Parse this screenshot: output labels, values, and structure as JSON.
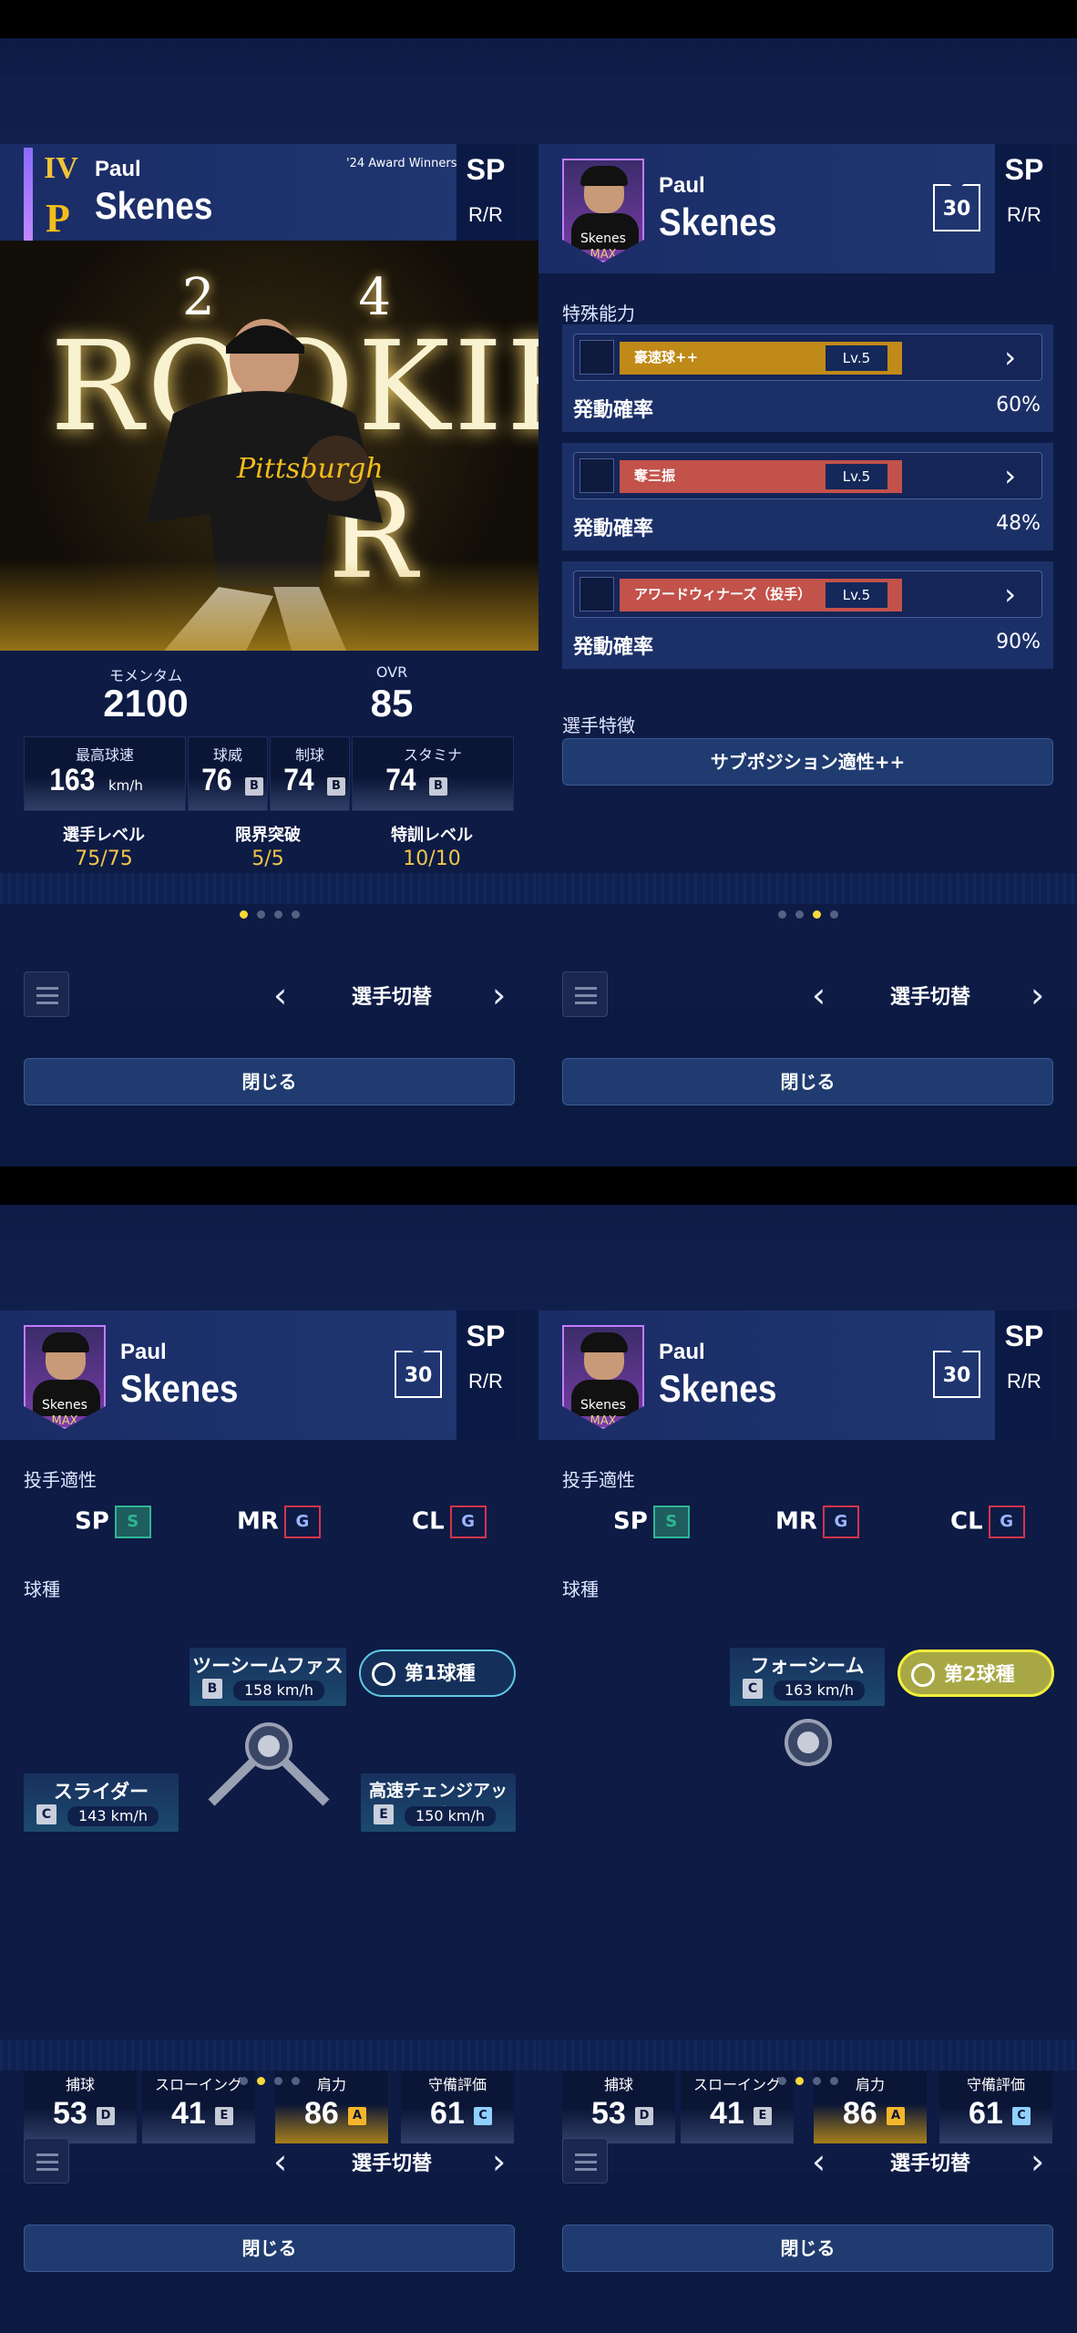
{
  "player": {
    "first": "Paul",
    "last": "Skenes",
    "position": "SP",
    "throws": "R/R",
    "number": "30",
    "rank": "IV",
    "max": "MAX",
    "avatar_name": "Skenes",
    "award": "'24 Award Winners"
  },
  "card": {
    "year": "2 4",
    "word1": "ROOKIE",
    "word2": "R"
  },
  "stats": {
    "momentum_label": "モメンタム",
    "momentum": "2100",
    "ovr_label": "OVR",
    "ovr": "85"
  },
  "attrs": [
    {
      "label": "最高球速",
      "value": "163",
      "unit": "km/h",
      "grade": ""
    },
    {
      "label": "球威",
      "value": "76",
      "grade": "B"
    },
    {
      "label": "制球",
      "value": "74",
      "grade": "B"
    },
    {
      "label": "スタミナ",
      "value": "74",
      "grade": "B"
    }
  ],
  "levels": [
    {
      "label": "選手レベル",
      "value": "75/75"
    },
    {
      "label": "限界突破",
      "value": "5/5"
    },
    {
      "label": "特訓レベル",
      "value": "10/10"
    }
  ],
  "abilities_title": "特殊能力",
  "abilities": [
    {
      "name": "豪速球++",
      "lv": "Lv.5",
      "rate_label": "発動確率",
      "rate": "60%",
      "color": "#c08a18"
    },
    {
      "name": "奪三振",
      "lv": "Lv.5",
      "rate_label": "発動確率",
      "rate": "48%",
      "color": "#c2524a"
    },
    {
      "name": "アワードウィナーズ（投手）",
      "lv": "Lv.5",
      "rate_label": "発動確率",
      "rate": "90%",
      "color": "#c2524a"
    }
  ],
  "trait_title": "選手特徴",
  "trait": "サブポジション適性++",
  "nav": {
    "switch": "選手切替",
    "close": "閉じる",
    "prev": "‹",
    "next": "›"
  },
  "aptitude_title": "投手適性",
  "aptitude": [
    {
      "pos": "SP",
      "grade": "S",
      "color": "#2fb593"
    },
    {
      "pos": "MR",
      "grade": "G",
      "color": "#d6344a"
    },
    {
      "pos": "CL",
      "grade": "G",
      "color": "#d6344a"
    }
  ],
  "pitch_title": "球種",
  "pitches1": {
    "badge": "第1球種",
    "main": {
      "name": "ツーシームファスト",
      "grade": "B",
      "speed": "158 km/h"
    },
    "left": {
      "name": "スライダー",
      "grade": "C",
      "speed": "143 km/h"
    },
    "right": {
      "name": "高速チェンジアップ",
      "grade": "E",
      "speed": "150 km/h"
    }
  },
  "pitches2": {
    "badge": "第2球種",
    "main": {
      "name": "フォーシーム",
      "grade": "C",
      "speed": "163 km/h"
    }
  },
  "fielding": [
    {
      "label": "捕球",
      "value": "53",
      "grade": "D"
    },
    {
      "label": "スローイング",
      "value": "41",
      "grade": "E"
    },
    {
      "label": "肩力",
      "value": "86",
      "grade": "A"
    },
    {
      "label": "守備評価",
      "value": "61",
      "grade": "C"
    }
  ]
}
